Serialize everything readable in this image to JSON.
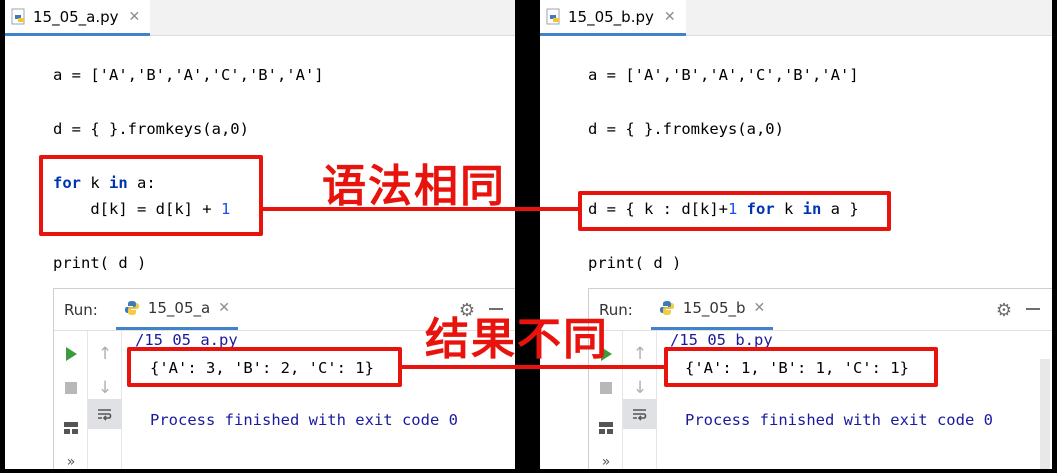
{
  "left_editor": {
    "tab_label": "15_05_a.py",
    "code_lines": {
      "list": "a = ['A','B','A','C','B','A']",
      "dict": "d = { }.fromkeys(a,0)",
      "loop_for": "for",
      "loop_var": " k ",
      "loop_in": "in",
      "loop_iter": " a:",
      "loop_body": "    d[k] = d[k] + ",
      "loop_num": "1",
      "print": "print( d )"
    },
    "run_panel": {
      "label": "Run:",
      "tab": "15_05_a",
      "path": "/15_05_a.py",
      "result": "{'A': 3, 'B': 2, 'C': 1}",
      "status": "Process finished with exit code 0"
    }
  },
  "right_editor": {
    "tab_label": "15_05_b.py",
    "code_lines": {
      "list": "a = ['A','B','A','C','B','A']",
      "dict": "d = { }.fromkeys(a,0)",
      "comp_start": "d = { k : d[k]+",
      "comp_num": "1",
      "comp_for": "for",
      "comp_var": " k ",
      "comp_in": "in",
      "comp_end": " a }",
      "print": "print( d )"
    },
    "run_panel": {
      "label": "Run:",
      "tab": "15_05_b",
      "path": "/15_05_b.py",
      "result": "{'A': 1, 'B': 1, 'C': 1}",
      "status": "Process finished with exit code 0"
    }
  },
  "annotations": {
    "syntax": "语法相同",
    "result": "结果不同",
    "color": "#e8130c"
  },
  "icons": [
    "python-file-icon",
    "close-icon",
    "python-icon",
    "gear-icon",
    "run-icon",
    "stop-icon",
    "up-arrow-icon",
    "down-arrow-icon",
    "soft-wrap-icon",
    "layout-icon",
    "more-icon"
  ]
}
